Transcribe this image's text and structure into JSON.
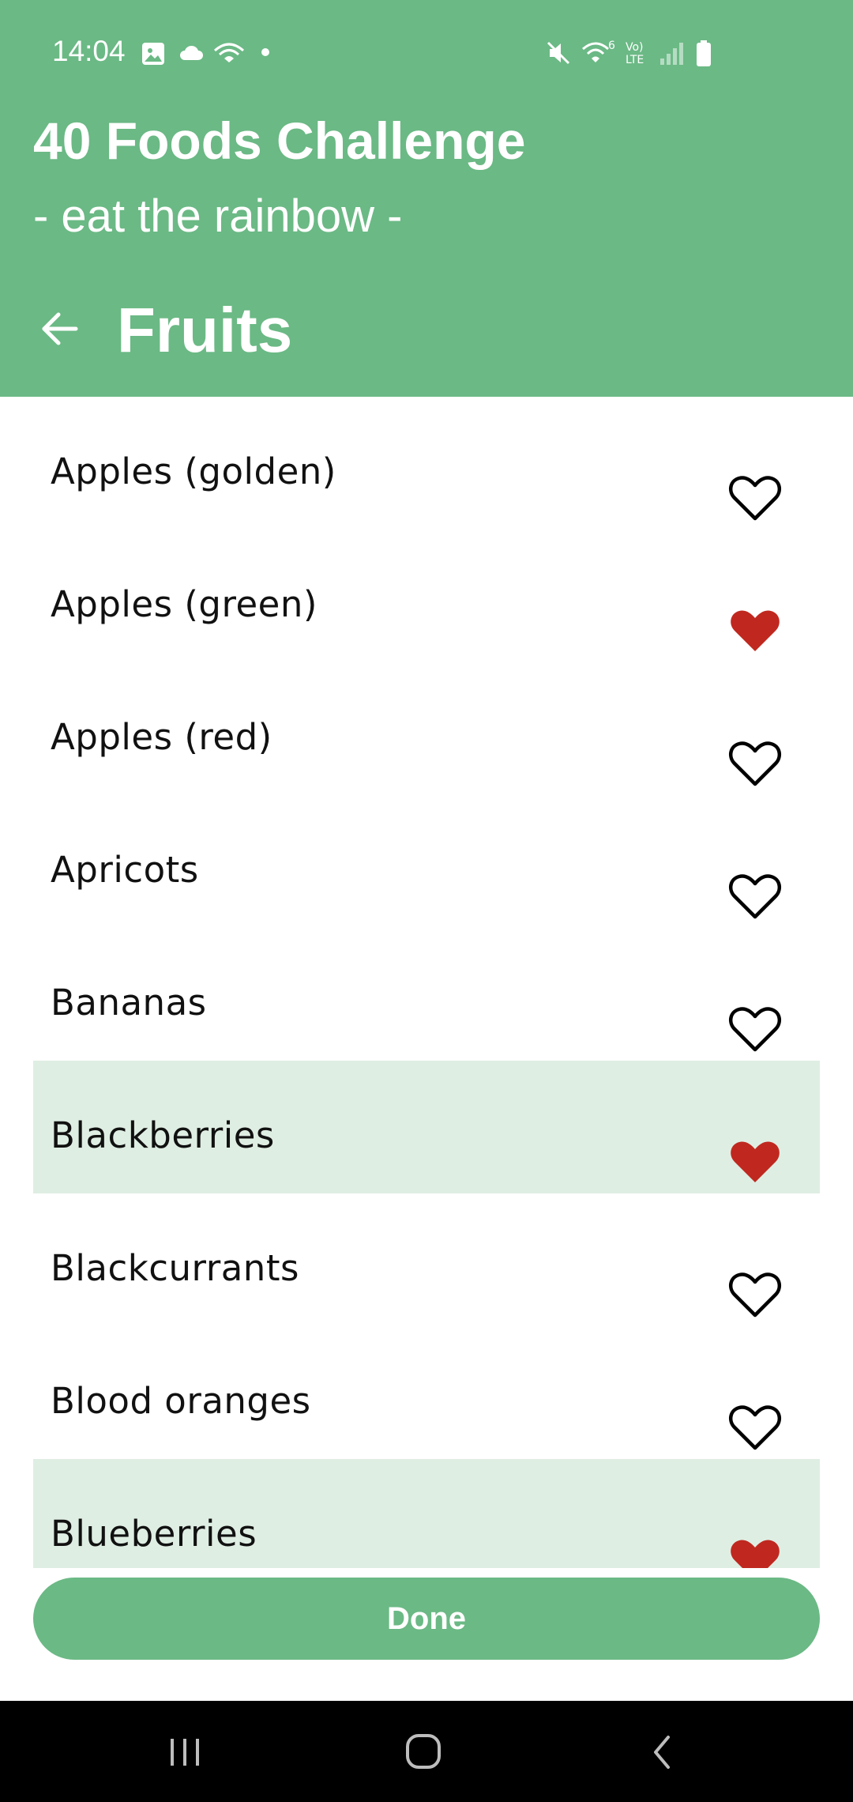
{
  "status_bar": {
    "time": "14:04",
    "icons": [
      "image-icon",
      "cloud-icon",
      "wifi-calling-icon",
      "dot-icon",
      "mute-icon",
      "wifi-6-icon",
      "volte-icon",
      "signal-icon",
      "battery-icon"
    ]
  },
  "header": {
    "title": "40 Foods Challenge",
    "subtitle": "- eat the rainbow -",
    "section": "Fruits",
    "back_icon": "arrow-left-icon"
  },
  "colors": {
    "accent": "#6bb985",
    "selected_row": "#dfeee3",
    "favorite_heart": "#c0281f",
    "outline_heart": "#000000"
  },
  "items": [
    {
      "label": "Apples (golden)",
      "favorite": false,
      "highlighted": false
    },
    {
      "label": "Apples (green)",
      "favorite": true,
      "highlighted": false
    },
    {
      "label": "Apples (red)",
      "favorite": false,
      "highlighted": false
    },
    {
      "label": "Apricots",
      "favorite": false,
      "highlighted": false
    },
    {
      "label": "Bananas",
      "favorite": false,
      "highlighted": false
    },
    {
      "label": "Blackberries",
      "favorite": true,
      "highlighted": true
    },
    {
      "label": "Blackcurrants",
      "favorite": false,
      "highlighted": false
    },
    {
      "label": "Blood oranges",
      "favorite": false,
      "highlighted": false
    },
    {
      "label": "Blueberries",
      "favorite": true,
      "highlighted": true
    }
  ],
  "done_button": {
    "label": "Done"
  },
  "nav_bar": {
    "icons": [
      "recent-apps-icon",
      "home-icon",
      "back-nav-icon"
    ]
  }
}
